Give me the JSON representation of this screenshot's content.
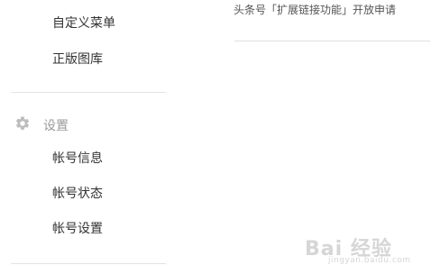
{
  "sidebar": {
    "top_items": [
      {
        "label": "自定义菜单"
      },
      {
        "label": "正版图库"
      }
    ],
    "settings_section": {
      "icon": "gear-icon",
      "title": "设置",
      "items": [
        {
          "label": "帐号信息"
        },
        {
          "label": "帐号状态"
        },
        {
          "label": "帐号设置"
        }
      ]
    }
  },
  "main": {
    "notice_text": "头条号「扩展链接功能」开放申请"
  },
  "watermark": {
    "main": "Bai 经验",
    "sub": "jingyan.baidu.com"
  },
  "colors": {
    "text": "#333333",
    "muted": "#9a9a9a",
    "divider": "#e3e3e3"
  }
}
